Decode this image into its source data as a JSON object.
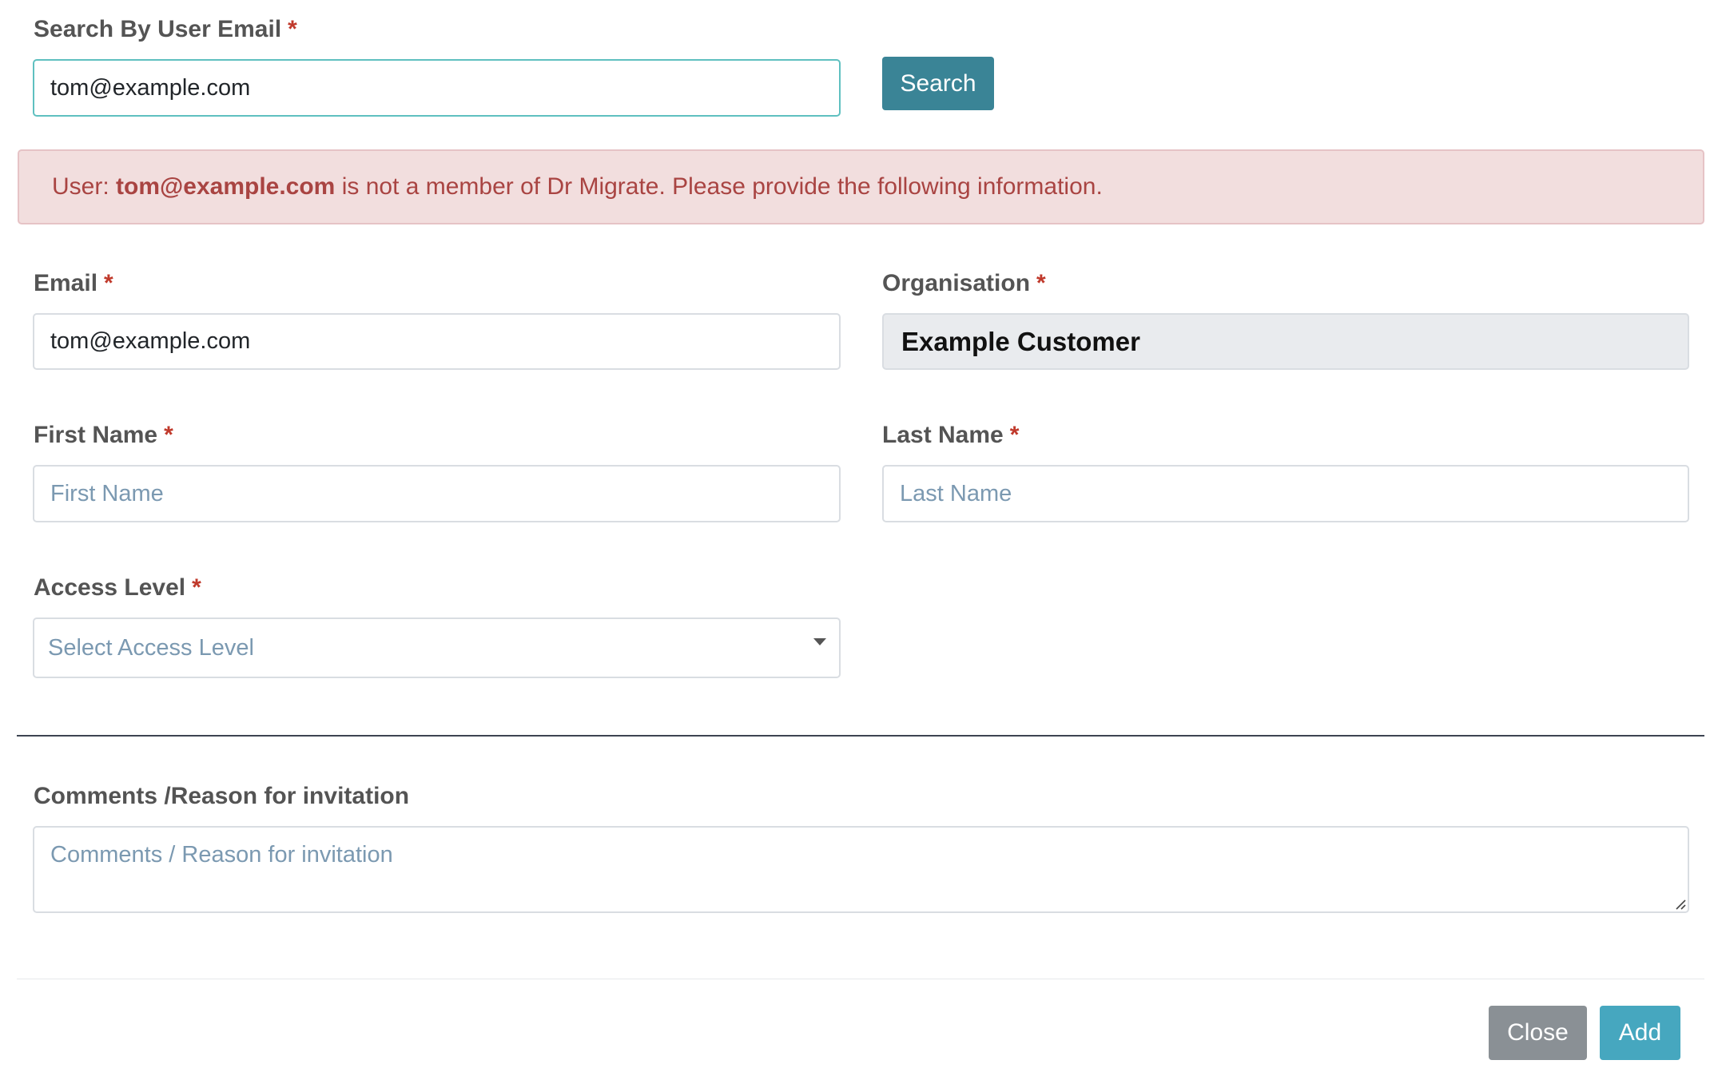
{
  "search": {
    "label": "Search By User Email",
    "required_mark": "*",
    "input_value": "tom@example.com",
    "button_label": "Search"
  },
  "alert": {
    "prefix": "User: ",
    "email": "tom@example.com",
    "suffix": " is not a member of Dr Migrate. Please provide the following information."
  },
  "form": {
    "email": {
      "label": "Email",
      "required_mark": "*",
      "value": "tom@example.com"
    },
    "organisation": {
      "label": "Organisation",
      "required_mark": "*",
      "value": "Example Customer"
    },
    "first_name": {
      "label": "First Name",
      "required_mark": "*",
      "placeholder": "First Name"
    },
    "last_name": {
      "label": "Last Name",
      "required_mark": "*",
      "placeholder": "Last Name"
    },
    "access_level": {
      "label": "Access Level",
      "required_mark": "*",
      "placeholder": "Select Access Level"
    },
    "comments": {
      "label": "Comments /Reason for invitation",
      "placeholder": "Comments / Reason for invitation"
    }
  },
  "footer": {
    "close_label": "Close",
    "add_label": "Add"
  },
  "colors": {
    "search_button": "#3a8496",
    "close_button": "#8a9095",
    "add_button": "#46a7bf",
    "alert_background": "#f2dede",
    "alert_text": "#a94442",
    "required_mark": "#c0392b",
    "placeholder": "#7b99b1"
  },
  "icons": {
    "select_arrow": "caret-down-icon",
    "textarea_resize": "resize-grip-icon"
  }
}
